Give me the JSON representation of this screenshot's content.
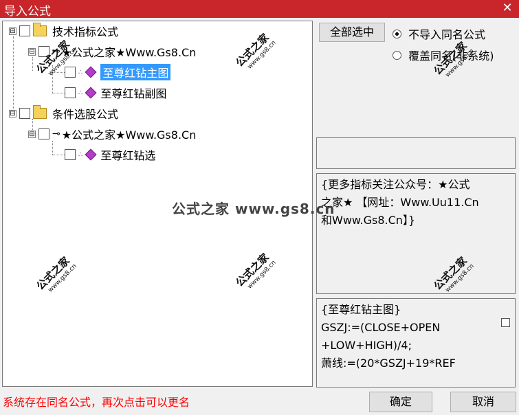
{
  "window": {
    "title": "导入公式",
    "close_glyph": "✕"
  },
  "tree": {
    "group1": {
      "label": "技术指标公式"
    },
    "group1_child": {
      "label": "★公式之家★Www.Gs8.Cn"
    },
    "group1_items": [
      "至尊红钻主图",
      "至尊红钻副图"
    ],
    "group2": {
      "label": "条件选股公式"
    },
    "group2_child": {
      "label": "★公式之家★Www.Gs8.Cn"
    },
    "group2_items": [
      "至尊红钻选"
    ],
    "expander": "⊟"
  },
  "controls": {
    "select_all": "全部选中",
    "radio_no_import": "不导入同名公式",
    "radio_overwrite": "覆盖同名(非系统)",
    "ok": "确定",
    "cancel": "取消"
  },
  "info": {
    "line1": "{更多指标关注公众号：★公式",
    "line2": "之家★ 【网址：Www.Uu11.Cn",
    "line3": "和Www.Gs8.Cn】}"
  },
  "code": {
    "line1": "{至尊红钻主图}",
    "line2": "GSZJ:=(CLOSE+OPEN",
    "line3": "+LOW+HIGH)/4;",
    "line4": "萧线:=(20*GSZJ+19*REF"
  },
  "watermark": {
    "banner": "公式之家 www.gs8.cn",
    "stamp": "公式之家",
    "stamp_sub": "www.gs8.cn"
  },
  "status": {
    "message": "系统存在同名公式，再次点击可以更名"
  }
}
